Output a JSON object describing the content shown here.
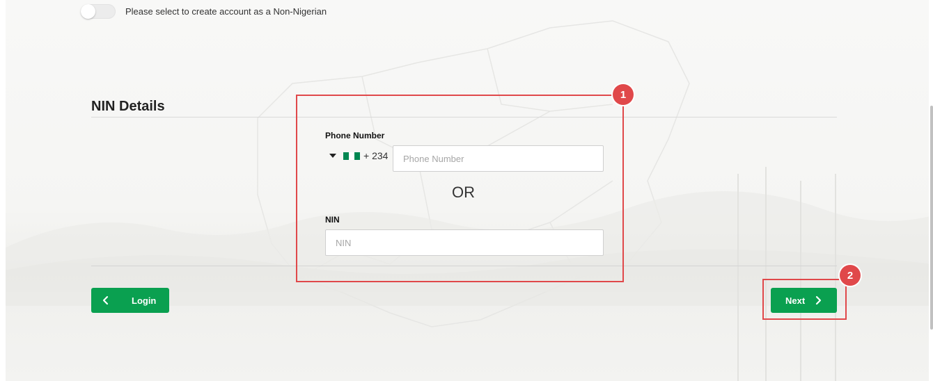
{
  "toggle": {
    "label": "Please select to create account as a Non-Nigerian",
    "checked": false
  },
  "section": {
    "title": "NIN Details"
  },
  "phone": {
    "label": "Phone Number",
    "dial_code": "+ 234",
    "placeholder": "Phone Number",
    "value": "",
    "flag_colors": [
      "#008751",
      "#ffffff",
      "#008751"
    ],
    "caret_icon": "caret-down-icon"
  },
  "separator": {
    "text": "OR"
  },
  "nin": {
    "label": "NIN",
    "placeholder": "NIN",
    "value": ""
  },
  "buttons": {
    "login": {
      "label": "Login",
      "icon": "chevron-left-icon"
    },
    "next": {
      "label": "Next",
      "icon": "chevron-right-icon"
    }
  },
  "annotations": [
    {
      "number": "1"
    },
    {
      "number": "2"
    }
  ],
  "colors": {
    "primary_green": "#0aa050",
    "annotation_red": "#e0484a"
  }
}
